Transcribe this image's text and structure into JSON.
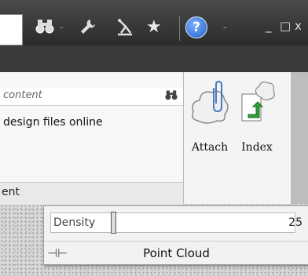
{
  "toolbar": {
    "icons": [
      "binoculars-icon",
      "wrench-icon",
      "satellite-icon",
      "star-icon",
      "help-icon"
    ],
    "help_label": "?",
    "dropdown_glyph": "-",
    "minimize_glyph": "_",
    "maximize_glyph": "□",
    "close_glyph": "x"
  },
  "search_panel": {
    "placeholder": "content",
    "result": "design files online",
    "footer": "ent"
  },
  "ribbon_buttons": [
    {
      "label": "Attach",
      "icon": "cloud-paperclip-icon"
    },
    {
      "label": "Index",
      "icon": "cloud-arrow-icon"
    }
  ],
  "point_cloud": {
    "density_label": "Density",
    "density_value": "25",
    "density_fraction": 0.25,
    "title": "Point Cloud"
  }
}
